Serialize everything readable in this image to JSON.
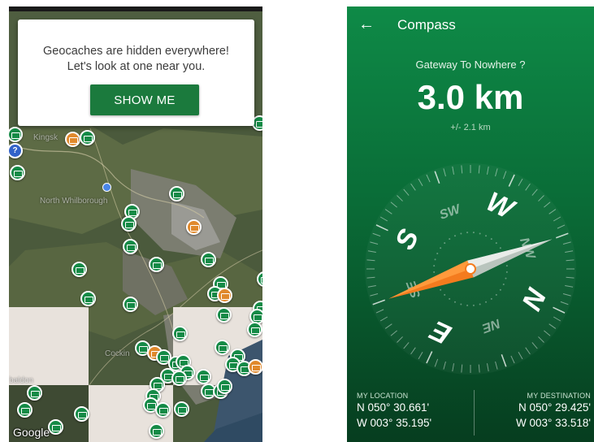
{
  "map_screen": {
    "onboarding": {
      "line1": "Geocaches are hidden everywhere!",
      "line2": "Let's look at one near you.",
      "button_label": "SHOW ME"
    },
    "map_labels": [
      "Kingsk",
      "North Whilborough",
      "Cockin",
      "baldon"
    ],
    "attribution": "Google",
    "marker_color": "#148a46",
    "highlight_marker_color": "#e0892c",
    "button_color": "#1b7a3d"
  },
  "compass_screen": {
    "app_bar": {
      "back_icon": "arrow-left-icon",
      "title": "Compass"
    },
    "cache_name": "Gateway To Nowhere ?",
    "distance": "3.0 km",
    "accuracy": "+/- 2.1 km",
    "dial": {
      "headings": [
        "N",
        "NE",
        "E",
        "SE",
        "S",
        "SW",
        "W",
        "NW"
      ],
      "needle_color": "#f47b1e",
      "background_color": "#0a6c37"
    },
    "my_location": {
      "label": "MY LOCATION",
      "lat": "N 050° 30.661'",
      "lon": "W 003° 35.195'"
    },
    "my_destination": {
      "label": "MY DESTINATION",
      "lat": "N 050° 29.425'",
      "lon": "W 003° 33.518'"
    }
  }
}
